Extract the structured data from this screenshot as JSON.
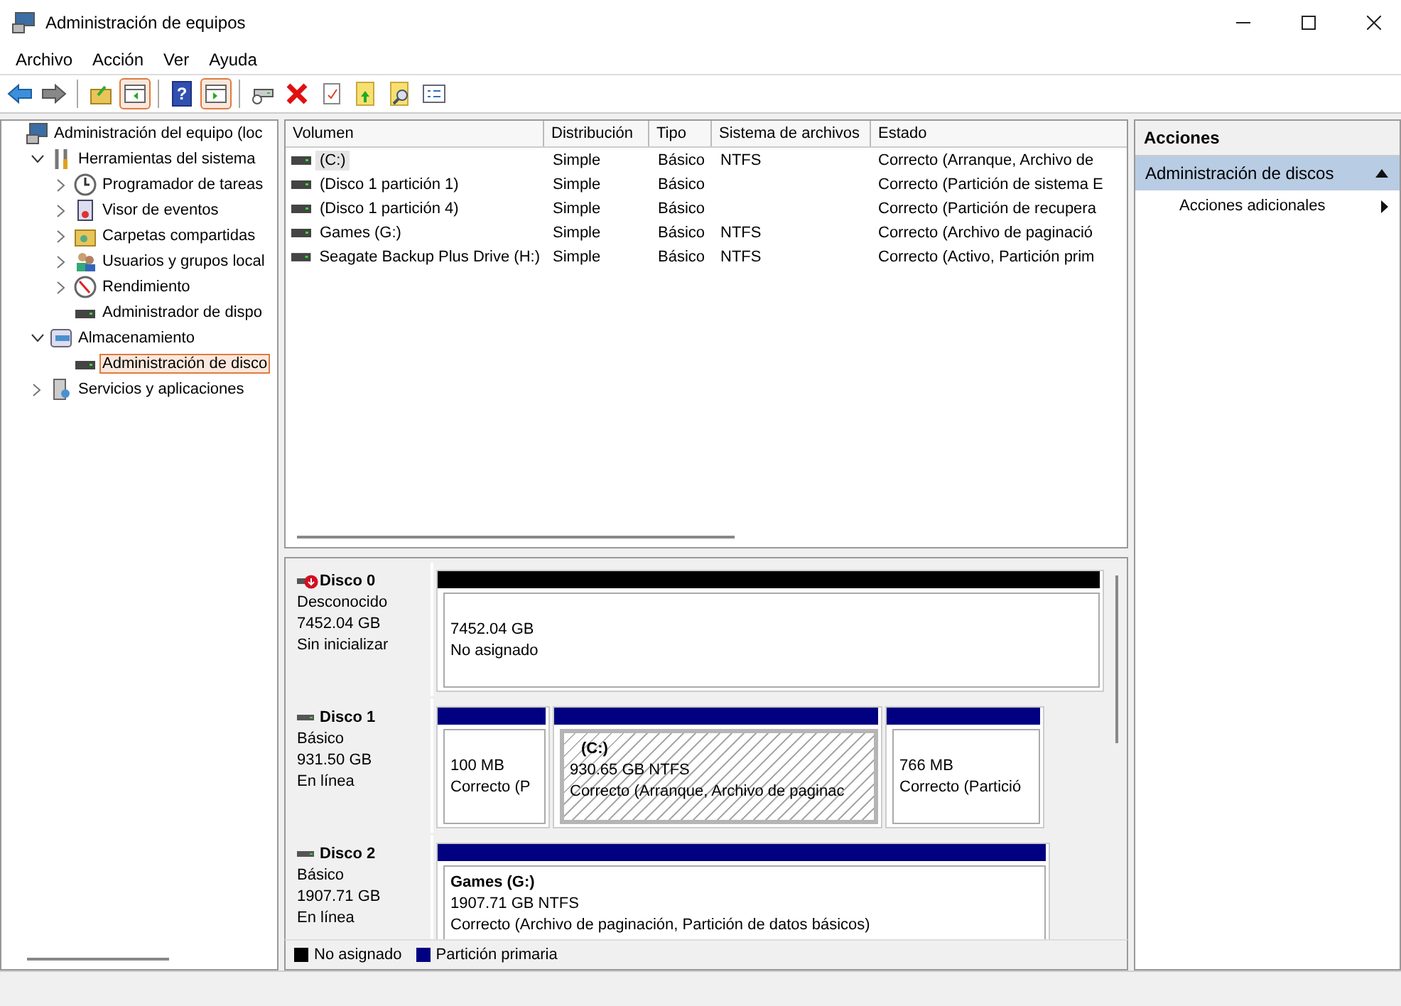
{
  "window": {
    "title": "Administración de equipos"
  },
  "menu": [
    "Archivo",
    "Acción",
    "Ver",
    "Ayuda"
  ],
  "toolbar": [
    {
      "kind": "back",
      "on": false
    },
    {
      "kind": "forward",
      "on": false
    },
    {
      "kind": "up-folder",
      "on": false
    },
    {
      "kind": "tree-pane",
      "on": true
    },
    {
      "kind": "help",
      "on": false,
      "label": "?"
    },
    {
      "kind": "action-pane",
      "on": true
    },
    {
      "kind": "connect",
      "on": false
    },
    {
      "kind": "delete",
      "on": false
    },
    {
      "kind": "properties",
      "on": false
    },
    {
      "kind": "export",
      "on": false
    },
    {
      "kind": "find",
      "on": false
    },
    {
      "kind": "list",
      "on": false
    }
  ],
  "tree": [
    {
      "label": "Administración del equipo (loc",
      "selected": false,
      "children": [
        {
          "label": "Herramientas del sistema",
          "expanded": true,
          "selected": false,
          "children": [
            {
              "label": "Programador de tareas",
              "expanded": false,
              "selected": false
            },
            {
              "label": "Visor de eventos",
              "expanded": false,
              "selected": false
            },
            {
              "label": "Carpetas compartidas",
              "expanded": false,
              "selected": false
            },
            {
              "label": "Usuarios y grupos local",
              "expanded": false,
              "selected": false
            },
            {
              "label": "Rendimiento",
              "expanded": false,
              "selected": false
            },
            {
              "label": "Administrador de dispo",
              "selected": false
            }
          ]
        },
        {
          "label": "Almacenamiento",
          "expanded": true,
          "selected": false,
          "children": [
            {
              "label": "Administración de disco",
              "selected": true
            }
          ]
        },
        {
          "label": "Servicios y aplicaciones",
          "expanded": false,
          "selected": false
        }
      ]
    }
  ],
  "volumes": {
    "columns": [
      "Volumen",
      "Distribución",
      "Tipo",
      "Sistema de archivos",
      "Estado"
    ],
    "rows": [
      {
        "cells": [
          "(C:)",
          "Simple",
          "Básico",
          "NTFS",
          "Correcto (Arranque, Archivo de"
        ],
        "selected": true
      },
      {
        "cells": [
          "(Disco 1 partición 1)",
          "Simple",
          "Básico",
          "",
          "Correcto (Partición de sistema E"
        ],
        "selected": false
      },
      {
        "cells": [
          "(Disco 1 partición 4)",
          "Simple",
          "Básico",
          "",
          "Correcto (Partición de recupera"
        ],
        "selected": false
      },
      {
        "cells": [
          "Games (G:)",
          "Simple",
          "Básico",
          "NTFS",
          "Correcto (Archivo de paginació"
        ],
        "selected": false
      },
      {
        "cells": [
          "Seagate Backup Plus Drive (H:)",
          "Simple",
          "Básico",
          "NTFS",
          "Correcto (Activo, Partición prim"
        ],
        "selected": false
      }
    ]
  },
  "disks": [
    {
      "name": "Disco 0",
      "kind": "unknown",
      "type": "Desconocido",
      "size": "7452.04 GB",
      "status": "Sin inicializar",
      "partitions": [
        {
          "kind": "unallocated",
          "selected": false,
          "lines": [
            "7452.04 GB",
            "No asignado"
          ]
        }
      ]
    },
    {
      "name": "Disco 1",
      "kind": "basic",
      "type": "Básico",
      "size": "931.50 GB",
      "status": "En línea",
      "partitions": [
        {
          "kind": "primary",
          "selected": false,
          "lines": [
            "100 MB",
            "Correcto (P"
          ]
        },
        {
          "kind": "primary",
          "selected": true,
          "name": "(C:)",
          "lines": [
            "930.65 GB NTFS",
            "Correcto (Arranque, Archivo de paginac"
          ]
        },
        {
          "kind": "primary",
          "selected": false,
          "lines": [
            "766 MB",
            "Correcto (Partició"
          ]
        }
      ]
    },
    {
      "name": "Disco 2",
      "kind": "basic",
      "type": "Básico",
      "size": "1907.71 GB",
      "status": "En línea",
      "partitions": [
        {
          "kind": "primary",
          "selected": false,
          "name": "Games  (G:)",
          "lines": [
            "1907.71 GB NTFS",
            "Correcto (Archivo de paginación, Partición de datos básicos)"
          ]
        }
      ]
    }
  ],
  "legend": [
    {
      "label": "No asignado",
      "color": "#000000"
    },
    {
      "label": "Partición primaria",
      "color": "#000080"
    }
  ],
  "actions": {
    "title": "Acciones",
    "section": {
      "label": "Administración de discos",
      "expanded": true
    },
    "items": [
      "Acciones adicionales"
    ]
  }
}
